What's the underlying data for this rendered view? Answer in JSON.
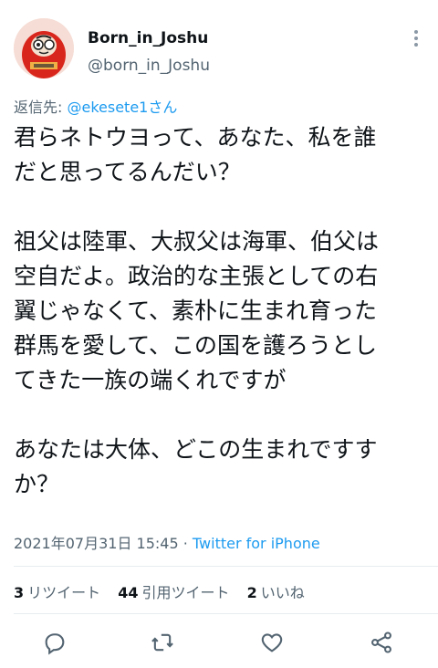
{
  "user": {
    "display_name": "Born_in_Joshu",
    "handle": "@born_in_Joshu"
  },
  "reply": {
    "prefix": "返信先: ",
    "target": "@ekesete1さん"
  },
  "tweet": {
    "lines": [
      "君らネトウヨって、あなた、私を誰",
      "だと思ってるんだい？",
      "",
      "祖父は陸軍、大叔父は海軍、伯父は",
      "空自だよ。政治的な主張としての右",
      "翼じゃなくて、素朴に生まれ育った",
      "群馬を愛して、この国を護ろうとし",
      "てきた一族の端くれですが",
      "",
      "あなたは大体、どこの生まれですす",
      "か？"
    ]
  },
  "meta": {
    "timestamp": "2021年07月31日 15:45",
    "separator": " · ",
    "source": "Twitter for iPhone"
  },
  "stats": {
    "retweets_count": "3",
    "retweets_label": "リツイート",
    "quotes_count": "44",
    "quotes_label": "引用ツイート",
    "likes_count": "2",
    "likes_label": "いいね"
  },
  "icons": {
    "reply": "reply-icon",
    "retweet": "retweet-icon",
    "like": "heart-icon",
    "share": "share-icon",
    "more": "more-vertical-icon"
  },
  "colors": {
    "link": "#1d9bf0",
    "secondary_text": "#536471",
    "primary_text": "#0f1419"
  }
}
